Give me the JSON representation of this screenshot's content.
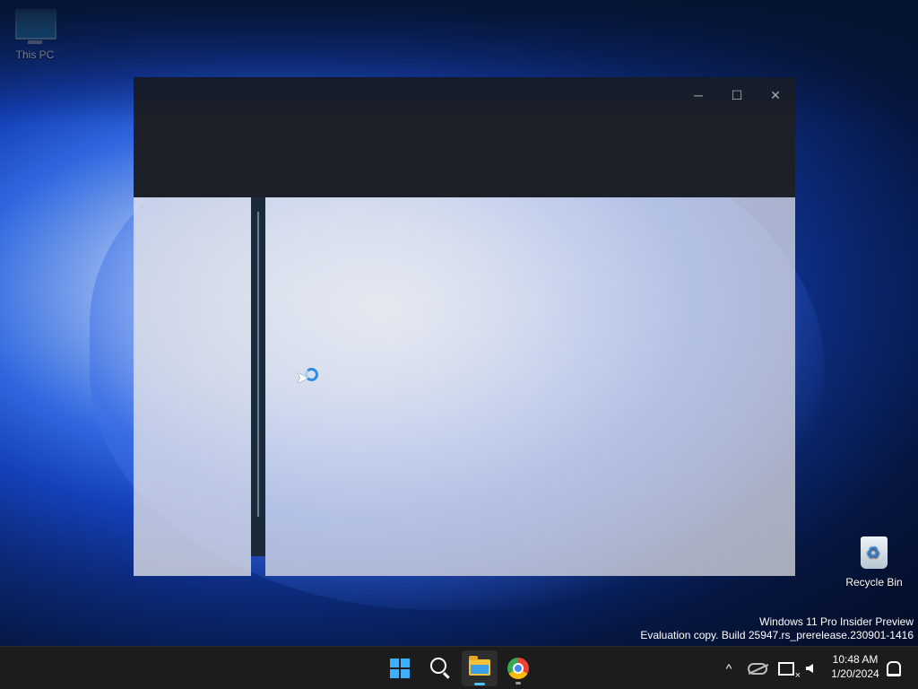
{
  "desktop": {
    "icons": [
      {
        "label": "This PC",
        "icon": "monitor-icon"
      },
      {
        "label": "Recycle Bin",
        "icon": "recycle-bin-icon"
      }
    ],
    "watermark": {
      "line1": "Windows 11 Pro Insider Preview",
      "line2": "Evaluation copy. Build 25947.rs_prerelease.230901-1416"
    }
  },
  "window": {
    "controls": {
      "minimize": "─",
      "maximize": "☐",
      "close": "✕"
    }
  },
  "taskbar": {
    "apps": [
      {
        "name": "Start",
        "icon": "windows-start-icon"
      },
      {
        "name": "Search",
        "icon": "search-icon"
      },
      {
        "name": "File Explorer",
        "icon": "folder-icon",
        "active": true
      },
      {
        "name": "Google Chrome",
        "icon": "chrome-icon",
        "running": true
      }
    ],
    "tray": {
      "chevron": "^",
      "time": "10:48 AM",
      "date": "1/20/2024"
    }
  },
  "colors": {
    "taskbar": "#1c1c1c",
    "titlebar": "#1d2028",
    "accent": "#3ab0ff"
  }
}
